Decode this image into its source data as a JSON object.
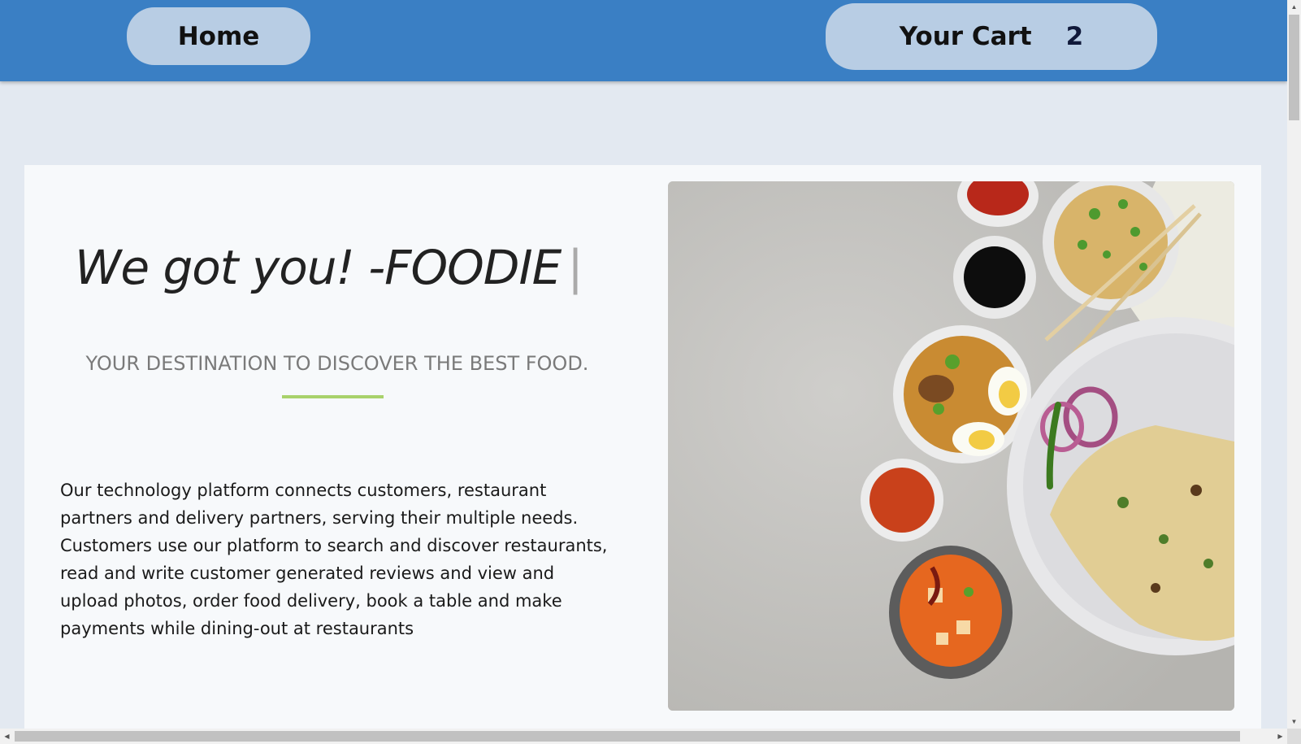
{
  "nav": {
    "home_label": "Home",
    "cart_label": "Your Cart",
    "cart_count": "2"
  },
  "hero": {
    "title": "We got you! -FOODIE",
    "cursor": "|",
    "tagline": "YOUR DESTINATION TO DISCOVER THE BEST FOOD.",
    "description": "Our technology platform connects customers, restaurant partners and delivery partners, serving their multiple needs. Customers use our platform to search and discover restaurants, read and write customer generated reviews and view and upload photos, order food delivery, book a table and make payments while dining-out at restaurants"
  },
  "image": {
    "alt": "Overhead view of Indian dishes: biryani with boiled eggs, noodles with chopsticks, naan with onion rings and chilli, paneer curry, and sauces"
  },
  "colors": {
    "navbar": "#3a7fc4",
    "nav_button": "#b8cde4",
    "page_bg": "#e3e9f1",
    "card_bg": "#f7f9fb",
    "divider": "#a9d26b"
  },
  "icons": {
    "scroll_up": "arrow-up-icon",
    "scroll_down": "arrow-down-icon",
    "scroll_left": "arrow-left-icon",
    "scroll_right": "arrow-right-icon"
  }
}
